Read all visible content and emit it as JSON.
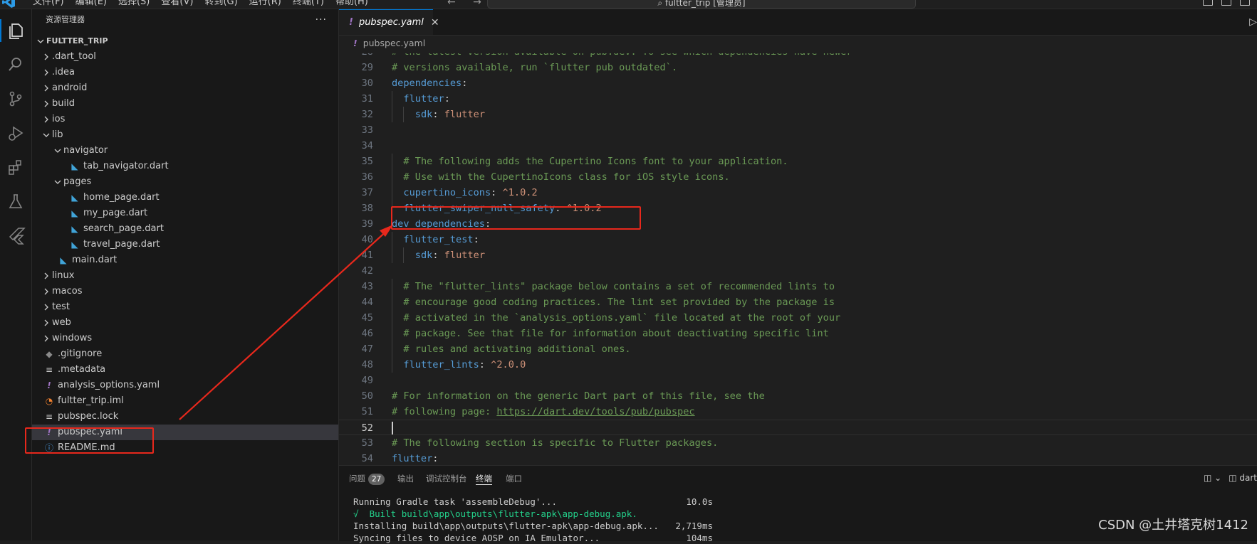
{
  "titlebar": {
    "menus": [
      "文件(F)",
      "编辑(E)",
      "选择(S)",
      "查看(V)",
      "转到(G)",
      "运行(R)",
      "终端(T)",
      "帮助(H)"
    ],
    "search_text": "fultter_trip [管理员]"
  },
  "activitybar": {
    "icons": [
      "explorer-icon",
      "search-icon",
      "source-control-icon",
      "run-debug-icon",
      "extensions-icon",
      "testing-icon",
      "flutter-icon"
    ]
  },
  "sidebar": {
    "title": "资源管理器",
    "more": "···",
    "project": "FULTTER_TRIP",
    "items": [
      {
        "label": ".dart_tool",
        "kind": "folder",
        "depth": 0,
        "open": false
      },
      {
        "label": ".idea",
        "kind": "folder",
        "depth": 0,
        "open": false
      },
      {
        "label": "android",
        "kind": "folder",
        "depth": 0,
        "open": false
      },
      {
        "label": "build",
        "kind": "folder",
        "depth": 0,
        "open": false
      },
      {
        "label": "ios",
        "kind": "folder",
        "depth": 0,
        "open": false
      },
      {
        "label": "lib",
        "kind": "folder",
        "depth": 0,
        "open": true
      },
      {
        "label": "navigator",
        "kind": "folder",
        "depth": 1,
        "open": true
      },
      {
        "label": "tab_navigator.dart",
        "kind": "dart",
        "depth": 2
      },
      {
        "label": "pages",
        "kind": "folder",
        "depth": 1,
        "open": true
      },
      {
        "label": "home_page.dart",
        "kind": "dart",
        "depth": 2
      },
      {
        "label": "my_page.dart",
        "kind": "dart",
        "depth": 2
      },
      {
        "label": "search_page.dart",
        "kind": "dart",
        "depth": 2
      },
      {
        "label": "travel_page.dart",
        "kind": "dart",
        "depth": 2
      },
      {
        "label": "main.dart",
        "kind": "dart",
        "depth": 1
      },
      {
        "label": "linux",
        "kind": "folder",
        "depth": 0,
        "open": false
      },
      {
        "label": "macos",
        "kind": "folder",
        "depth": 0,
        "open": false
      },
      {
        "label": "test",
        "kind": "folder",
        "depth": 0,
        "open": false
      },
      {
        "label": "web",
        "kind": "folder",
        "depth": 0,
        "open": false
      },
      {
        "label": "windows",
        "kind": "folder",
        "depth": 0,
        "open": false
      },
      {
        "label": ".gitignore",
        "kind": "git",
        "depth": 0
      },
      {
        "label": ".metadata",
        "kind": "lines",
        "depth": 0
      },
      {
        "label": "analysis_options.yaml",
        "kind": "yaml",
        "depth": 0
      },
      {
        "label": "fultter_trip.iml",
        "kind": "rss",
        "depth": 0
      },
      {
        "label": "pubspec.lock",
        "kind": "lines",
        "depth": 0
      },
      {
        "label": "pubspec.yaml",
        "kind": "yaml",
        "depth": 0,
        "selected": true
      },
      {
        "label": "README.md",
        "kind": "info",
        "depth": 0
      }
    ]
  },
  "editor": {
    "tab_label": "pubspec.yaml",
    "breadcrumb": "pubspec.yaml",
    "lines": [
      {
        "n": "28",
        "indent": 0,
        "tokens": [
          [
            "cm",
            "# the latest version available on pub.dev. To see which dependencies have newer"
          ]
        ]
      },
      {
        "n": "29",
        "indent": 0,
        "tokens": [
          [
            "cm",
            "# versions available, run `flutter pub outdated`."
          ]
        ]
      },
      {
        "n": "30",
        "indent": 0,
        "tokens": [
          [
            "ky",
            "dependencies"
          ],
          [
            "pn",
            ":"
          ]
        ]
      },
      {
        "n": "31",
        "indent": 1,
        "tokens": [
          [
            "ky",
            "flutter"
          ],
          [
            "pn",
            ":"
          ]
        ]
      },
      {
        "n": "32",
        "indent": 2,
        "tokens": [
          [
            "ky",
            "sdk"
          ],
          [
            "pn",
            ": "
          ],
          [
            "vs",
            "flutter"
          ]
        ]
      },
      {
        "n": "33",
        "indent": 0,
        "tokens": []
      },
      {
        "n": "34",
        "indent": 0,
        "tokens": []
      },
      {
        "n": "35",
        "indent": 1,
        "tokens": [
          [
            "cm",
            "# The following adds the Cupertino Icons font to your application."
          ]
        ]
      },
      {
        "n": "36",
        "indent": 1,
        "tokens": [
          [
            "cm",
            "# Use with the CupertinoIcons class for iOS style icons."
          ]
        ]
      },
      {
        "n": "37",
        "indent": 1,
        "tokens": [
          [
            "ky",
            "cupertino_icons"
          ],
          [
            "pn",
            ": "
          ],
          [
            "vs",
            "^1.0.2"
          ]
        ]
      },
      {
        "n": "38",
        "indent": 1,
        "tokens": [
          [
            "ky",
            "flutter_swiper_null_safety"
          ],
          [
            "pn",
            ": "
          ],
          [
            "vs",
            "^1.0.2"
          ]
        ]
      },
      {
        "n": "39",
        "indent": 0,
        "tokens": [
          [
            "ky",
            "dev_dependencies"
          ],
          [
            "pn",
            ":"
          ]
        ]
      },
      {
        "n": "40",
        "indent": 1,
        "tokens": [
          [
            "ky",
            "flutter_test"
          ],
          [
            "pn",
            ":"
          ]
        ]
      },
      {
        "n": "41",
        "indent": 2,
        "tokens": [
          [
            "ky",
            "sdk"
          ],
          [
            "pn",
            ": "
          ],
          [
            "vs",
            "flutter"
          ]
        ]
      },
      {
        "n": "42",
        "indent": 0,
        "tokens": []
      },
      {
        "n": "43",
        "indent": 1,
        "tokens": [
          [
            "cm",
            "# The \"flutter_lints\" package below contains a set of recommended lints to"
          ]
        ]
      },
      {
        "n": "44",
        "indent": 1,
        "tokens": [
          [
            "cm",
            "# encourage good coding practices. The lint set provided by the package is"
          ]
        ]
      },
      {
        "n": "45",
        "indent": 1,
        "tokens": [
          [
            "cm",
            "# activated in the `analysis_options.yaml` file located at the root of your"
          ]
        ]
      },
      {
        "n": "46",
        "indent": 1,
        "tokens": [
          [
            "cm",
            "# package. See that file for information about deactivating specific lint"
          ]
        ]
      },
      {
        "n": "47",
        "indent": 1,
        "tokens": [
          [
            "cm",
            "# rules and activating additional ones."
          ]
        ]
      },
      {
        "n": "48",
        "indent": 1,
        "tokens": [
          [
            "ky",
            "flutter_lints"
          ],
          [
            "pn",
            ": "
          ],
          [
            "vs",
            "^2.0.0"
          ]
        ]
      },
      {
        "n": "49",
        "indent": 0,
        "tokens": []
      },
      {
        "n": "50",
        "indent": 0,
        "tokens": [
          [
            "cm",
            "# For information on the generic Dart part of this file, see the"
          ]
        ]
      },
      {
        "n": "51",
        "indent": 0,
        "tokens": [
          [
            "cm",
            "# following page: "
          ],
          [
            "lk",
            "https://dart.dev/tools/pub/pubspec"
          ]
        ]
      },
      {
        "n": "52",
        "indent": 0,
        "tokens": [],
        "current": true
      },
      {
        "n": "53",
        "indent": 0,
        "tokens": [
          [
            "cm",
            "# The following section is specific to Flutter packages."
          ]
        ]
      },
      {
        "n": "54",
        "indent": 0,
        "tokens": [
          [
            "ky",
            "flutter"
          ],
          [
            "pn",
            ":"
          ]
        ]
      }
    ]
  },
  "panel": {
    "tabs": [
      {
        "label": "问题",
        "badge": "27"
      },
      {
        "label": "输出"
      },
      {
        "label": "调试控制台"
      },
      {
        "label": "终端",
        "active": true
      },
      {
        "label": "端口"
      }
    ],
    "right_label": "dart",
    "terminal": [
      {
        "text": "Running Gradle task 'assembleDebug'...",
        "time": "10.0s",
        "kind": "plain"
      },
      {
        "text": "√  Built build\\app\\outputs\\flutter-apk\\app-debug.apk.",
        "time": "",
        "kind": "ok"
      },
      {
        "text": "Installing build\\app\\outputs\\flutter-apk\\app-debug.apk...",
        "time": "2,719ms",
        "kind": "plain"
      },
      {
        "text": "Syncing files to device AOSP on IA Emulator...",
        "time": "104ms",
        "kind": "plain"
      }
    ]
  },
  "watermark": "CSDN @土井塔克树1412",
  "colors": {
    "accent": "#0078d4",
    "annotation_red": "#e8281c",
    "comment": "#6a9955",
    "key": "#569cd6",
    "string": "#ce9178"
  }
}
